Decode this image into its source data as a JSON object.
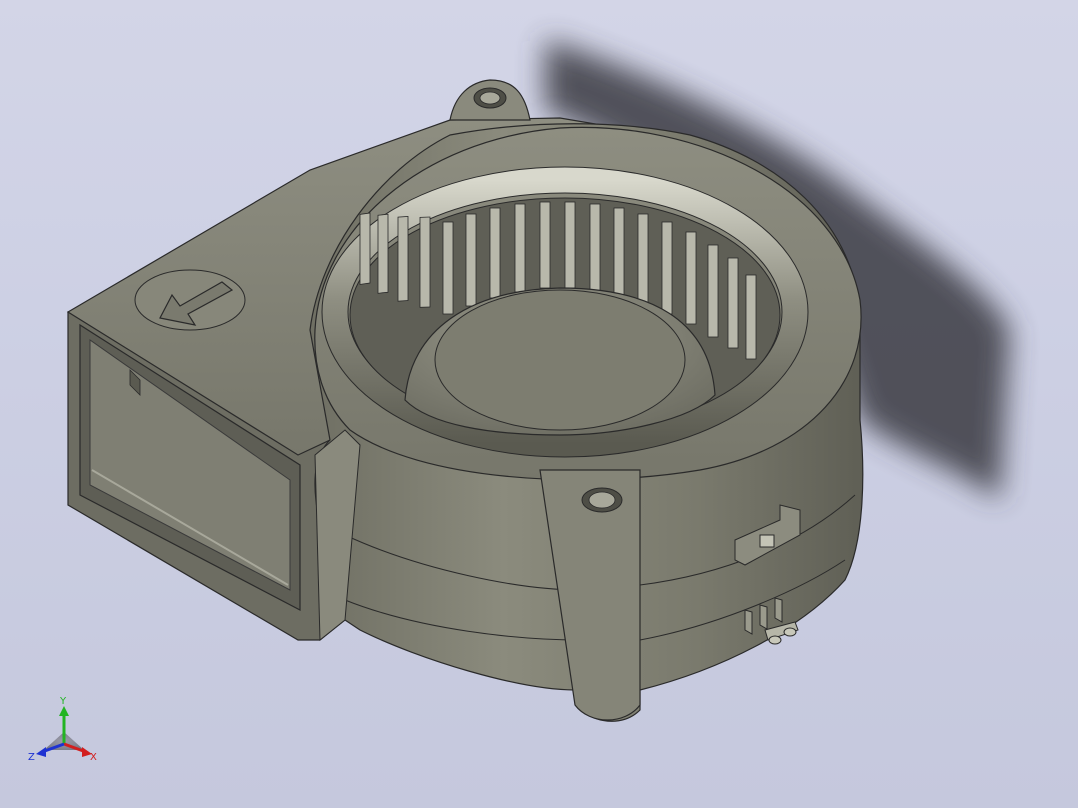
{
  "viewport": {
    "background_top": "#d3d5e7",
    "background_bottom": "#c5c8dd"
  },
  "model": {
    "body_color": "#7d7d70",
    "highlight_color": "#c9c9bd",
    "shadow_color": "#3a3a42"
  },
  "triad": {
    "y_label": "Y",
    "x_label": "X",
    "z_label": "Z",
    "y_color": "#22b422",
    "x_color": "#d21e1e",
    "z_color": "#1e32d2"
  },
  "icons": {
    "direction_marker": "arrow-left-down-icon"
  }
}
